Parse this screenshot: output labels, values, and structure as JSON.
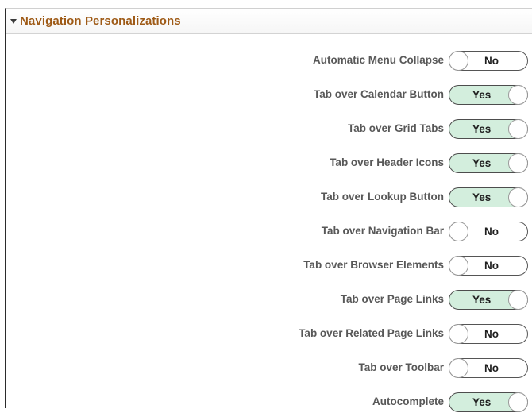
{
  "section": {
    "title": "Navigation Personalizations",
    "expanded_icon": "triangle-down-icon"
  },
  "settings": [
    {
      "label": "Automatic Menu Collapse",
      "value": "No",
      "on": false
    },
    {
      "label": "Tab over Calendar Button",
      "value": "Yes",
      "on": true
    },
    {
      "label": "Tab over Grid Tabs",
      "value": "Yes",
      "on": true
    },
    {
      "label": "Tab over Header Icons",
      "value": "Yes",
      "on": true
    },
    {
      "label": "Tab over Lookup Button",
      "value": "Yes",
      "on": true
    },
    {
      "label": "Tab over Navigation Bar",
      "value": "No",
      "on": false
    },
    {
      "label": "Tab over Browser Elements",
      "value": "No",
      "on": false
    },
    {
      "label": "Tab over Page Links",
      "value": "Yes",
      "on": true
    },
    {
      "label": "Tab over Related Page Links",
      "value": "No",
      "on": false
    },
    {
      "label": "Tab over Toolbar",
      "value": "No",
      "on": false
    },
    {
      "label": "Autocomplete",
      "value": "Yes",
      "on": true
    }
  ],
  "colors": {
    "title": "#9e5a16",
    "label": "#585858",
    "toggle_on_bg": "#d3eedd",
    "toggle_off_bg": "#ffffff"
  }
}
